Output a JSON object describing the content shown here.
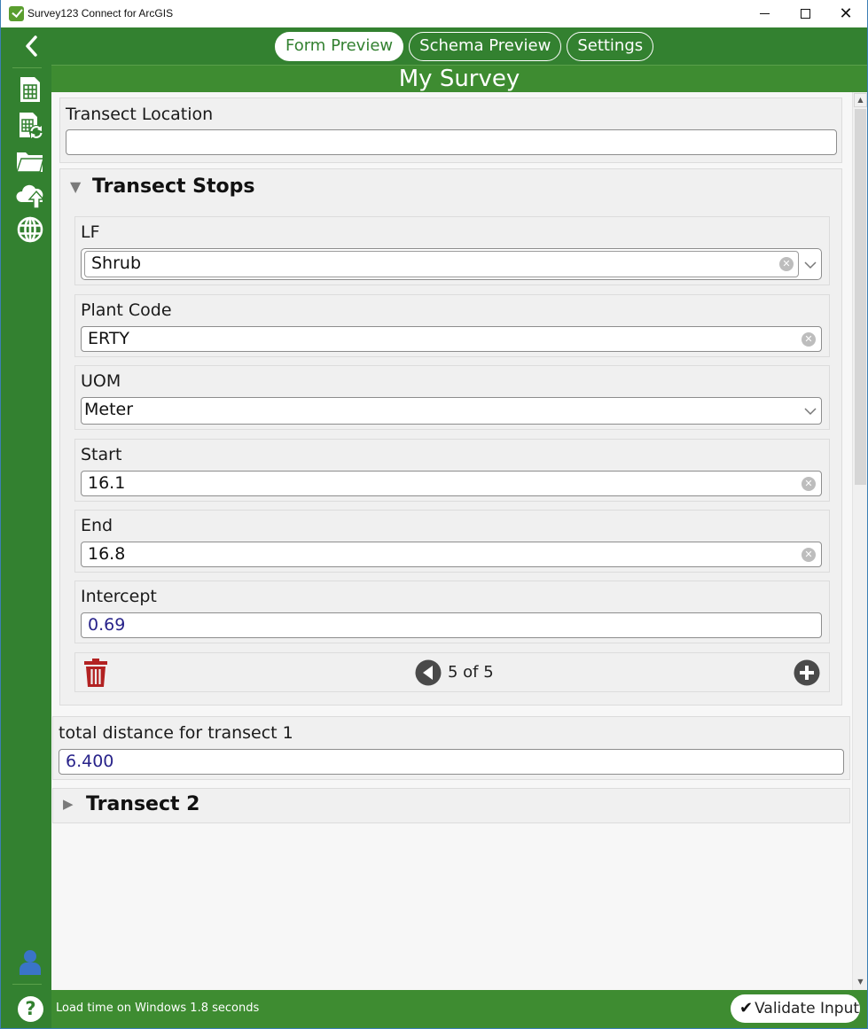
{
  "window": {
    "title": "Survey123 Connect for ArcGIS",
    "controls": {
      "minimize": "minimize",
      "maximize": "maximize",
      "close": "✕"
    }
  },
  "header": {
    "back_icon": "chevron-left-icon",
    "tabs": [
      {
        "label": "Form Preview",
        "active": true
      },
      {
        "label": "Schema Preview",
        "active": false
      },
      {
        "label": "Settings",
        "active": false
      }
    ],
    "survey_title": "My Survey"
  },
  "sidebar": {
    "items": [
      {
        "icon": "new-survey-icon",
        "label": "New Survey"
      },
      {
        "icon": "update-survey-icon",
        "label": "Update Survey"
      },
      {
        "icon": "folder-icon",
        "label": "Open Folder"
      },
      {
        "icon": "cloud-upload-icon",
        "label": "Publish"
      },
      {
        "icon": "globe-icon",
        "label": "Web"
      }
    ],
    "user_icon": "user-icon"
  },
  "form": {
    "transect_location": {
      "label": "Transect Location",
      "value": ""
    },
    "transect_stops": {
      "title": "Transect Stops",
      "expanded": true,
      "fields": {
        "lf": {
          "label": "LF",
          "value": "Shrub"
        },
        "plant_code": {
          "label": "Plant Code",
          "value": "ERTY"
        },
        "uom": {
          "label": "UOM",
          "value": "Meter"
        },
        "start": {
          "label": "Start",
          "value": "16.1"
        },
        "end": {
          "label": "End",
          "value": "16.8"
        },
        "intercept": {
          "label": "Intercept",
          "value": "0.69"
        }
      },
      "repeat_nav": {
        "text": "5 of 5",
        "current": 5,
        "total": 5
      }
    },
    "total_distance": {
      "label": "total distance for transect 1",
      "value": "6.400"
    },
    "transect2": {
      "title": "Transect 2",
      "expanded": false
    }
  },
  "footer": {
    "help_label": "?",
    "status": "Load time on Windows 1.8 seconds",
    "validate_label": "Validate Input"
  },
  "colors": {
    "brand_green": "#338130",
    "title_green": "#3e8c31",
    "delete_red": "#b22222",
    "computed_text": "#28238a"
  }
}
